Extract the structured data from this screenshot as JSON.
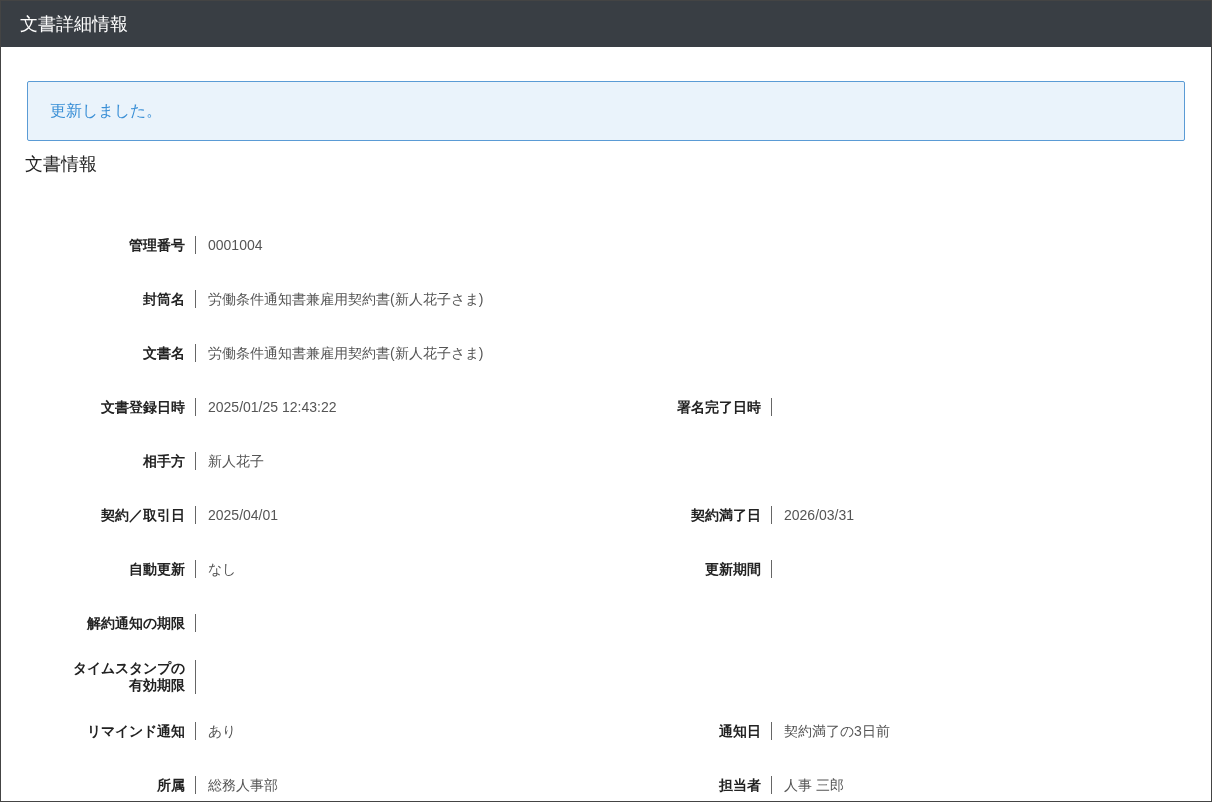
{
  "window": {
    "title": "文書詳細情報"
  },
  "alert": {
    "message": "更新しました。"
  },
  "section": {
    "title": "文書情報"
  },
  "rows": [
    {
      "left": {
        "label": "管理番号",
        "value": "0001004"
      }
    },
    {
      "left": {
        "label": "封筒名",
        "value": "労働条件通知書兼雇用契約書(新人花子さま)"
      }
    },
    {
      "left": {
        "label": "文書名",
        "value": "労働条件通知書兼雇用契約書(新人花子さま)"
      }
    },
    {
      "left": {
        "label": "文書登録日時",
        "value": "2025/01/25 12:43:22"
      },
      "right": {
        "label": "署名完了日時"
      }
    },
    {
      "left": {
        "label": "相手方",
        "value": "新人花子"
      }
    },
    {
      "left": {
        "label": "契約／取引日",
        "value": "2025/04/01"
      },
      "right": {
        "label": "契約満了日",
        "value": "2026/03/31"
      }
    },
    {
      "left": {
        "label": "自動更新",
        "value": "なし"
      },
      "right": {
        "label": "更新期間"
      }
    },
    {
      "left": {
        "label": "解約通知の期限"
      }
    },
    {
      "left": {
        "label": "タイムスタンプの有効期限"
      }
    },
    {
      "left": {
        "label": "リマインド通知",
        "value": "あり"
      },
      "right": {
        "label": "通知日",
        "value": "契約満了の3日前"
      }
    },
    {
      "left": {
        "label": "所属",
        "value": "総務人事部"
      },
      "right": {
        "label": "担当者",
        "value": "人事 三郎"
      }
    }
  ]
}
